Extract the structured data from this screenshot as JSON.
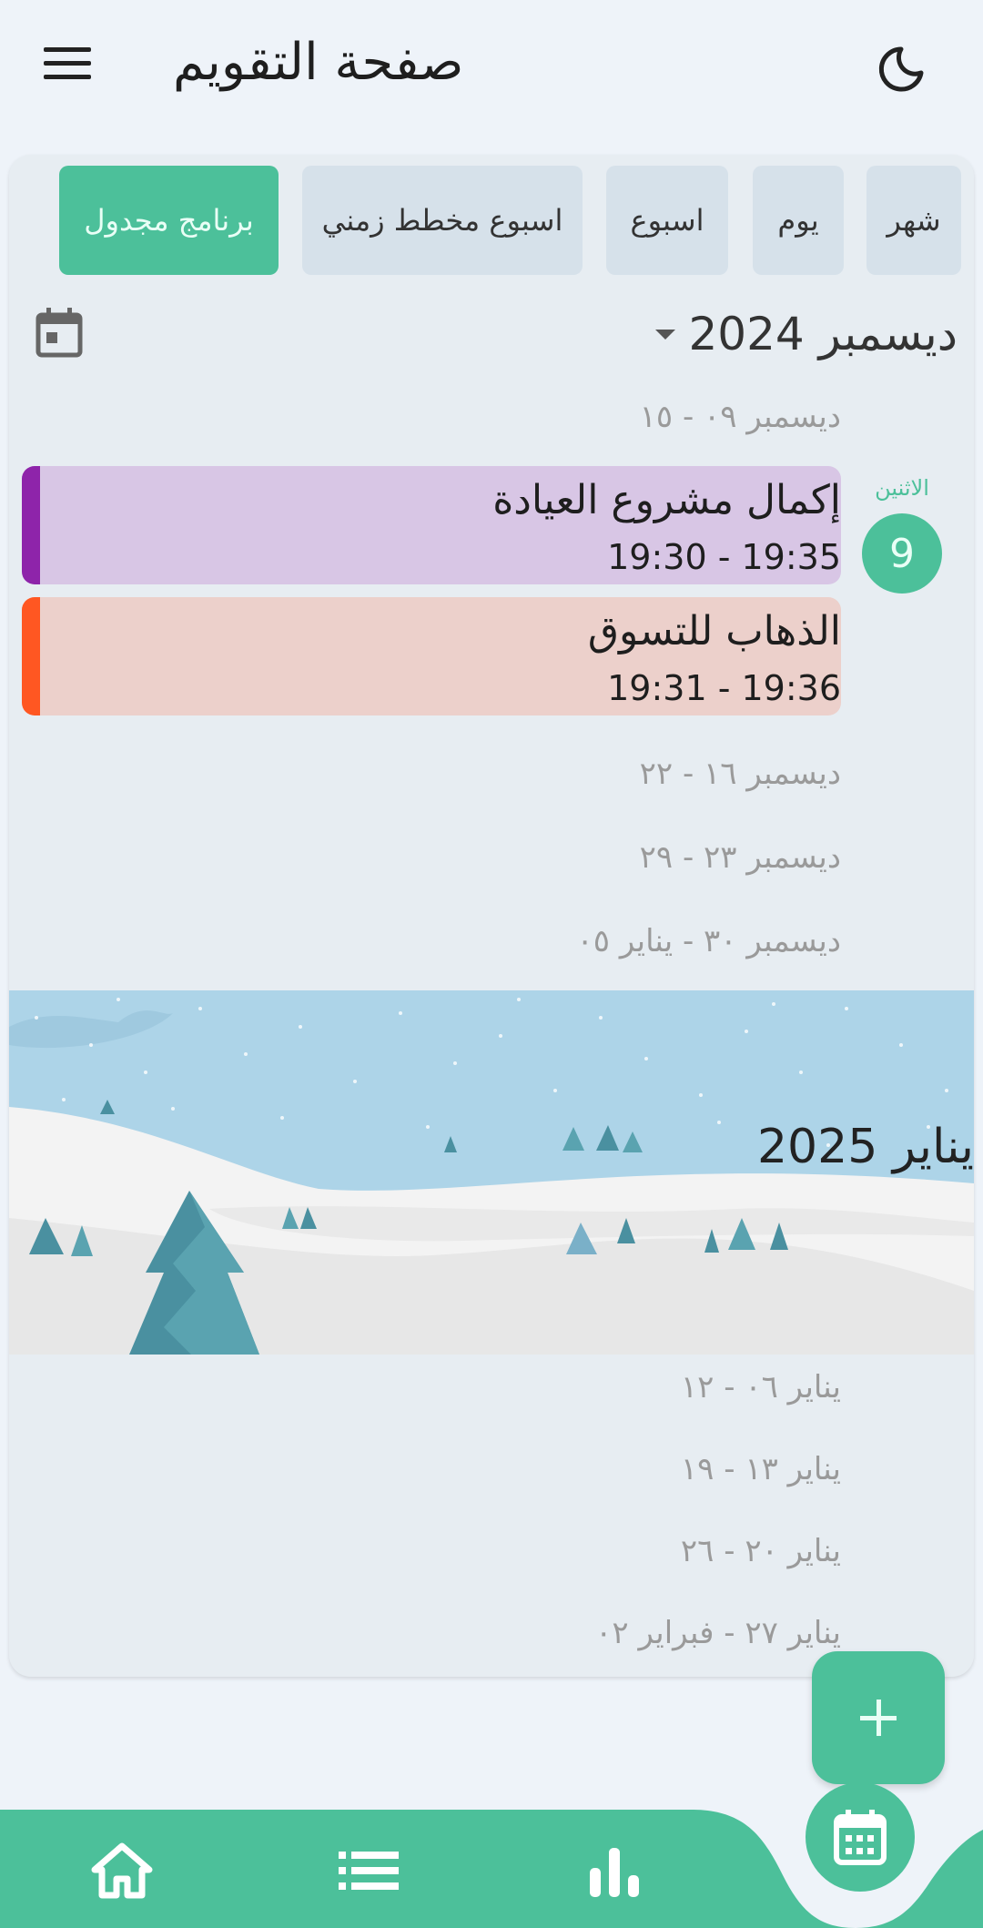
{
  "header": {
    "title": "صفحة التقويم"
  },
  "view_tabs": [
    {
      "label": "شهر"
    },
    {
      "label": "يوم"
    },
    {
      "label": "اسبوع"
    },
    {
      "label": "اسبوع مخطط زمني"
    },
    {
      "label": "برنامج مجدول",
      "active": true
    }
  ],
  "month_header": {
    "label": "ديسمبر 2024"
  },
  "weeks": {
    "week1": "ديسمبر ٠٩ - ١٥",
    "week2": "ديسمبر ١٦ - ٢٢",
    "week3": "ديسمبر ٢٣ - ٢٩",
    "week4": "ديسمبر ٣٠ - يناير ٠٥",
    "week5": "يناير ٠٦ - ١٢",
    "week6": "يناير ١٣ - ١٩",
    "week7": "يناير ٢٠ - ٢٦",
    "week8": "يناير ٢٧ - فبراير ٠٢"
  },
  "day": {
    "name": "الاثنين",
    "number": "9"
  },
  "events": [
    {
      "title": "إكمال مشروع العيادة",
      "time": "19:30 - 19:35",
      "color": "#8e24aa",
      "bg": "#d8c6e5"
    },
    {
      "title": "الذهاب للتسوق",
      "time": "19:31 - 19:36",
      "color": "#ff5722",
      "bg": "#ecd0cb"
    }
  ],
  "banner": {
    "title": "يناير 2025"
  },
  "colors": {
    "accent": "#4cc09a",
    "background": "#eef3f9",
    "card": "#e7edf2"
  },
  "nav": {
    "items": [
      "home-icon",
      "list-icon",
      "bar-chart-icon",
      "calendar-icon"
    ]
  }
}
